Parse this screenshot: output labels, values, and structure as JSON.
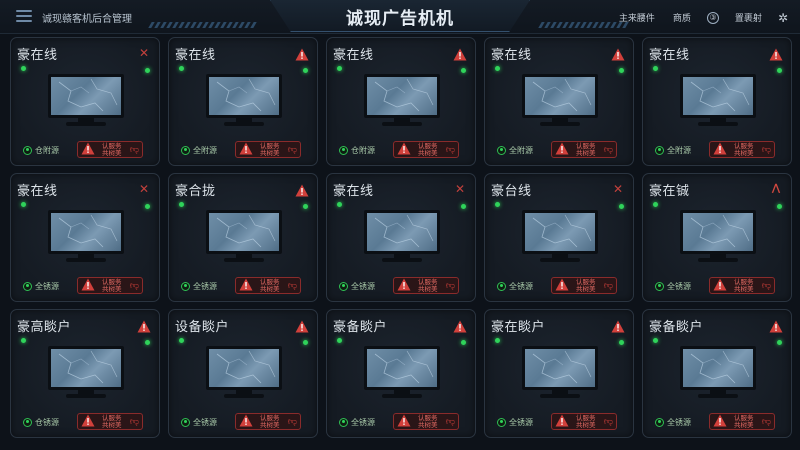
{
  "header": {
    "app_name": "诚现赣客机后合管理",
    "title": "诚现广告机机",
    "links": [
      "主来腰件",
      "商质",
      "③",
      "置裹射"
    ],
    "icons": [
      "menu-icon",
      "help-icon",
      "gear-icon"
    ]
  },
  "colors": {
    "accent": "#2fd35a",
    "alert": "#d1403b",
    "background": "#0d1219",
    "card": "#151b23"
  },
  "cards": [
    {
      "title": "豪在线",
      "status_icon": "x-icon",
      "status_label": "仓附源",
      "alert_text": "认服务\n共树美"
    },
    {
      "title": "豪在线",
      "status_icon": "warning-icon",
      "status_label": "全附源",
      "alert_text": "认服务\n共树美"
    },
    {
      "title": "豪在线",
      "status_icon": "warning-icon",
      "status_label": "仓附源",
      "alert_text": "认服务\n共树美"
    },
    {
      "title": "豪在线",
      "status_icon": "warning-icon",
      "status_label": "全附源",
      "alert_text": "认服务\n共树美"
    },
    {
      "title": "豪在线",
      "status_icon": "warning-icon",
      "status_label": "全附源",
      "alert_text": "认服务\n共树美"
    },
    {
      "title": "豪在线",
      "status_icon": "x-icon",
      "status_label": "全锈源",
      "alert_text": "认服务\n共树美"
    },
    {
      "title": "豪合拢",
      "status_icon": "warning-icon",
      "status_label": "全锈源",
      "alert_text": "认服务\n共树美"
    },
    {
      "title": "豪在线",
      "status_icon": "x-icon",
      "status_label": "全锈源",
      "alert_text": "认服务\n共树美"
    },
    {
      "title": "豪台线",
      "status_icon": "x-icon",
      "status_label": "全锈源",
      "alert_text": "认服务\n共树美"
    },
    {
      "title": "豪在铖",
      "status_icon": "chevron-up-icon",
      "status_label": "全锈源",
      "alert_text": "认服务\n共树美"
    },
    {
      "title": "豪高睒户",
      "status_icon": "warning-icon",
      "status_label": "仓锈源",
      "alert_text": "认服务\n共树美"
    },
    {
      "title": "设备睒户",
      "status_icon": "warning-icon",
      "status_label": "全锈源",
      "alert_text": "认服务\n共树美"
    },
    {
      "title": "豪备睒户",
      "status_icon": "warning-icon",
      "status_label": "全锈源",
      "alert_text": "认服务\n共树美"
    },
    {
      "title": "豪在睒户",
      "status_icon": "warning-icon",
      "status_label": "全锈源",
      "alert_text": "认服务\n共树美"
    },
    {
      "title": "豪备睒户",
      "status_icon": "warning-icon",
      "status_label": "全锈源",
      "alert_text": "认服务\n共树美"
    }
  ]
}
